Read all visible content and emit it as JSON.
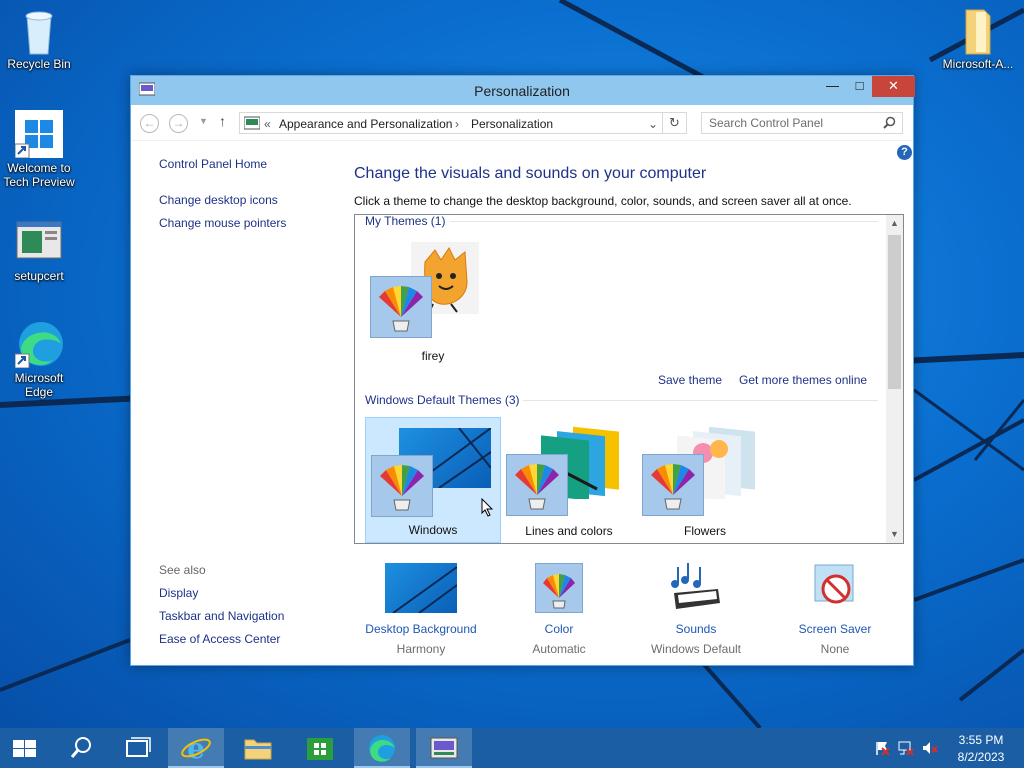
{
  "desktop": {
    "icons": [
      {
        "label": "Recycle Bin"
      },
      {
        "label": "Welcome to Tech Preview"
      },
      {
        "label": "setupcert"
      },
      {
        "label": "Microsoft Edge"
      },
      {
        "label": "Microsoft-A..."
      }
    ]
  },
  "window": {
    "title": "Personalization",
    "controls": {
      "minimize": "—",
      "maximize": "□",
      "close": "✕"
    }
  },
  "address": {
    "overflow": "«",
    "crumb1": "Appearance and Personalization",
    "sep": "›",
    "crumb2": "Personalization",
    "search_placeholder": "Search Control Panel"
  },
  "leftnav": {
    "home": "Control Panel Home",
    "links": [
      "Change desktop icons",
      "Change mouse pointers"
    ],
    "see_also": "See also",
    "see_also_links": [
      "Display",
      "Taskbar and Navigation",
      "Ease of Access Center"
    ]
  },
  "main": {
    "title": "Change the visuals and sounds on your computer",
    "subtitle": "Click a theme to change the desktop background, color, sounds, and screen saver all at once.",
    "my_themes": {
      "header": "My Themes (1)",
      "themes": [
        {
          "name": "firey"
        }
      ],
      "save": "Save theme",
      "more": "Get more themes online"
    },
    "default_themes": {
      "header": "Windows Default Themes (3)",
      "themes": [
        {
          "name": "Windows"
        },
        {
          "name": "Lines and colors"
        },
        {
          "name": "Flowers"
        }
      ]
    }
  },
  "bottom": [
    {
      "label": "Desktop Background",
      "value": "Harmony"
    },
    {
      "label": "Color",
      "value": "Automatic"
    },
    {
      "label": "Sounds",
      "value": "Windows Default"
    },
    {
      "label": "Screen Saver",
      "value": "None"
    }
  ],
  "taskbar": {
    "time": "3:55 PM",
    "date": "8/2/2023"
  },
  "colors": {
    "accent": "#1e3287",
    "titlebar": "#8fc7ef",
    "close": "#c8453b",
    "taskbar": "#1c5ea3",
    "selection": "#cce8ff"
  }
}
